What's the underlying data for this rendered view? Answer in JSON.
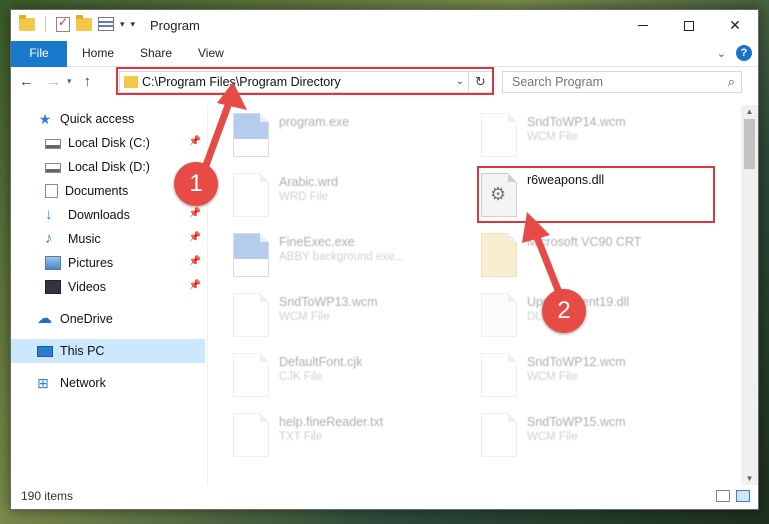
{
  "window": {
    "title": "Program",
    "controls": [
      "minimize",
      "maximize",
      "close"
    ]
  },
  "ribbon": {
    "tabs": [
      "File",
      "Home",
      "Share",
      "View"
    ],
    "help_label": "?"
  },
  "navigation": {
    "address_path": "C:\\Program Files\\Program Directory",
    "search_placeholder": "Search Program"
  },
  "sidebar": {
    "items": [
      {
        "label": "Quick access",
        "icon": "star-icon",
        "pinned": false
      },
      {
        "label": "Local Disk (C:)",
        "icon": "disk-icon",
        "pinned": true
      },
      {
        "label": "Local Disk (D:)",
        "icon": "disk-icon",
        "pinned": false
      },
      {
        "label": "Documents",
        "icon": "documents-icon",
        "pinned": true
      },
      {
        "label": "Downloads",
        "icon": "downloads-icon",
        "pinned": true
      },
      {
        "label": "Music",
        "icon": "music-icon",
        "pinned": true
      },
      {
        "label": "Pictures",
        "icon": "pictures-icon",
        "pinned": true
      },
      {
        "label": "Videos",
        "icon": "videos-icon",
        "pinned": true
      },
      {
        "label": "OneDrive",
        "icon": "cloud-icon",
        "pinned": false
      },
      {
        "label": "This PC",
        "icon": "pc-icon",
        "pinned": false,
        "selected": true
      },
      {
        "label": "Network",
        "icon": "network-icon",
        "pinned": false
      }
    ]
  },
  "files": [
    {
      "name": "program.exe",
      "type": "",
      "icon": "exe-icon"
    },
    {
      "name": "SndToWP14.wcm",
      "type": "WCM File",
      "icon": "file-icon"
    },
    {
      "name": "Arabic.wrd",
      "type": "WRD File",
      "icon": "file-icon"
    },
    {
      "name": "r6weapons.dll",
      "type": "",
      "icon": "dll-gear-icon",
      "highlighted": true
    },
    {
      "name": "FineExec.exe",
      "type": "ABBY background exe...",
      "icon": "exe-icon"
    },
    {
      "name": "Microsoft VC90 CRT",
      "type": "",
      "icon": "folder-icon"
    },
    {
      "name": "SndToWP13.wcm",
      "type": "WCM File",
      "icon": "file-icon"
    },
    {
      "name": "UpdateClient19.dll",
      "type": "DLL",
      "icon": "dll-gear-icon"
    },
    {
      "name": "DefaultFont.cjk",
      "type": "CJK File",
      "icon": "file-icon"
    },
    {
      "name": "SndToWP12.wcm",
      "type": "WCM File",
      "icon": "file-icon"
    },
    {
      "name": "help.fineReader.txt",
      "type": "TXT File",
      "icon": "file-icon"
    },
    {
      "name": "SndToWP15.wcm",
      "type": "WCM File",
      "icon": "file-icon"
    }
  ],
  "status": {
    "item_count": "190 items"
  },
  "annotations": {
    "step1": "1",
    "step2": "2",
    "color": "#e64b45"
  },
  "colors": {
    "accent": "#1979ca",
    "highlight_border": "#d9393e",
    "selection": "#cce8ff"
  }
}
